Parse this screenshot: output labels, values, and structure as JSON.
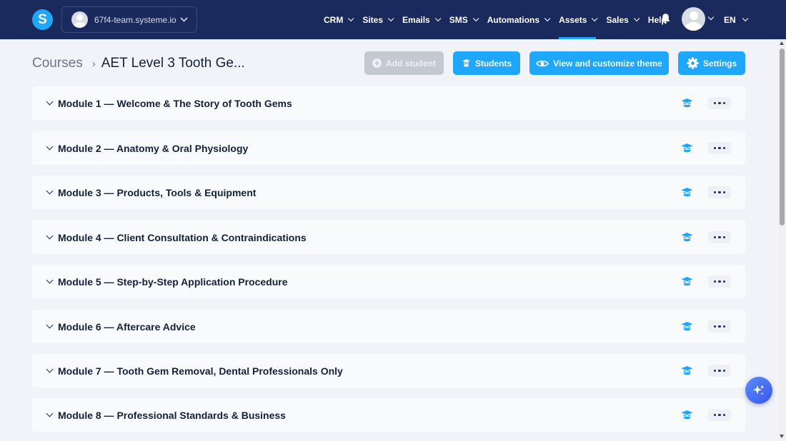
{
  "navbar": {
    "logo_letter": "S",
    "workspace_name": "67f4-team.systeme.io",
    "menu": [
      {
        "label": "CRM",
        "has_dropdown": true
      },
      {
        "label": "Sites",
        "has_dropdown": true
      },
      {
        "label": "Emails",
        "has_dropdown": true
      },
      {
        "label": "SMS",
        "has_dropdown": true
      },
      {
        "label": "Automations",
        "has_dropdown": true
      },
      {
        "label": "Assets",
        "has_dropdown": true,
        "active": true
      },
      {
        "label": "Sales",
        "has_dropdown": true
      },
      {
        "label": "Help",
        "has_dropdown": false
      }
    ],
    "language": "EN",
    "icons": [
      "bell-icon",
      "user-avatar",
      "chevron-down-icon"
    ]
  },
  "header": {
    "breadcrumb_root": "Courses",
    "breadcrumb_separator": "›",
    "course_title": "AET Level 3 Tooth Ge...",
    "buttons": {
      "add_student": "Add student",
      "students": "Students",
      "view_theme": "View and customize theme",
      "settings": "Settings"
    }
  },
  "modules": [
    {
      "title": "Module 1 — Welcome & The Story of Tooth Gems"
    },
    {
      "title": "Module 2 — Anatomy & Oral Physiology"
    },
    {
      "title": "Module 3 — Products, Tools & Equipment"
    },
    {
      "title": "Module 4 — Client Consultation & Contraindications"
    },
    {
      "title": "Module 5 — Step-by-Step Application Procedure"
    },
    {
      "title": "Module 6 — Aftercare Advice"
    },
    {
      "title": "Module 7 — Tooth Gem Removal, Dental Professionals Only"
    },
    {
      "title": "Module 8 — Professional Standards & Business"
    }
  ],
  "colors": {
    "navbar_bg": "#1b2a5c",
    "accent": "#1ea7fd",
    "disabled_button": "#c3c8d1",
    "page_bg": "#f1f3f8",
    "module_bg": "#f9fafc"
  }
}
